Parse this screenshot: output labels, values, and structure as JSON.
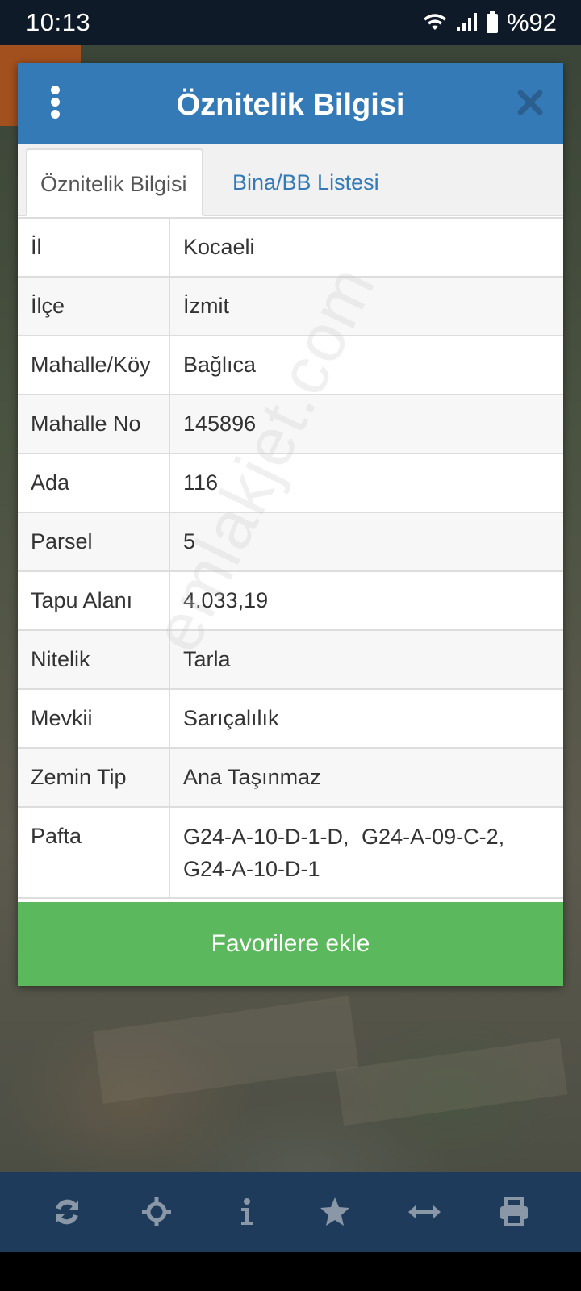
{
  "status": {
    "time": "10:13",
    "battery": "%92"
  },
  "modal": {
    "title": "Öznitelik Bilgisi",
    "tabs": [
      {
        "label": "Öznitelik Bilgisi",
        "active": true
      },
      {
        "label": "Bina/BB Listesi",
        "active": false
      }
    ],
    "rows": [
      {
        "key": "İl",
        "value": "Kocaeli"
      },
      {
        "key": "İlçe",
        "value": "İzmit"
      },
      {
        "key": "Mahalle/Köy",
        "value": "Bağlıca"
      },
      {
        "key": "Mahalle No",
        "value": "145896"
      },
      {
        "key": "Ada",
        "value": "116"
      },
      {
        "key": "Parsel",
        "value": "5"
      },
      {
        "key": "Tapu Alanı",
        "value": "4.033,19"
      },
      {
        "key": "Nitelik",
        "value": "Tarla"
      },
      {
        "key": "Mevkii",
        "value": "Sarıçalılık"
      },
      {
        "key": "Zemin Tip",
        "value": "Ana Taşınmaz"
      },
      {
        "key": "Pafta",
        "value": "G24-A-10-D-1-D, G24-A-09-C-2, G24-A-10-D-1"
      }
    ],
    "favorite_button": "Favorilere ekle"
  },
  "watermark": "emlakjet.com",
  "toolbar": {
    "icons": [
      "refresh-icon",
      "crosshair-icon",
      "info-icon",
      "star-icon",
      "horizontal-arrows-icon",
      "print-icon"
    ]
  },
  "colors": {
    "header": "#337ab7",
    "favorite": "#5cb85c",
    "toolbar": "#1f3b5b"
  }
}
